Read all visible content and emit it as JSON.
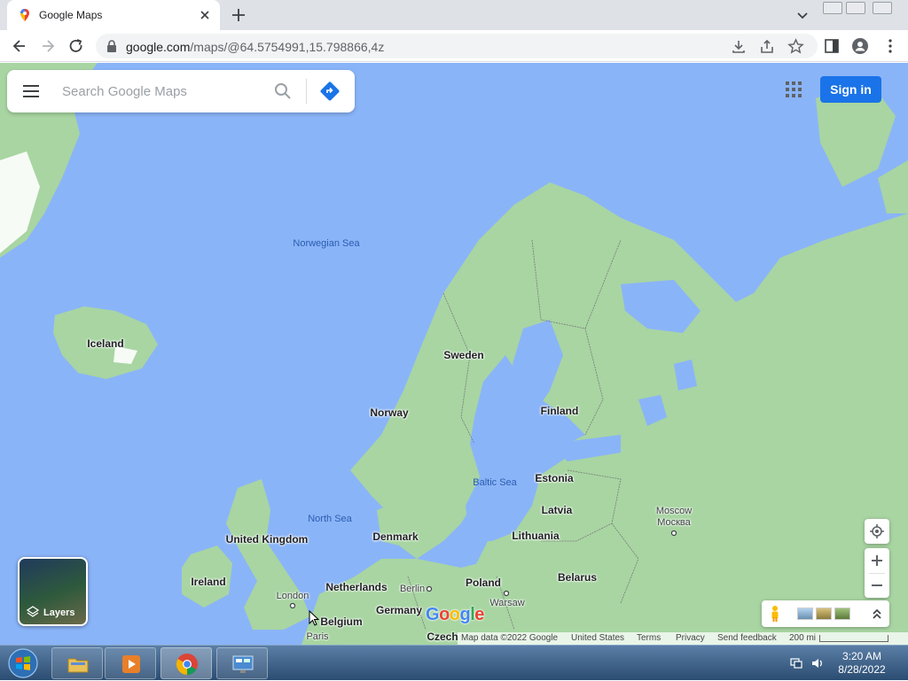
{
  "browser": {
    "tab_title": "Google Maps",
    "url_host": "google.com",
    "url_path": "/maps/@64.5754991,15.798866,4z"
  },
  "maps": {
    "search_placeholder": "Search Google Maps",
    "sign_in_label": "Sign in",
    "layers_label": "Layers",
    "logo_text": "Google",
    "logo_colors": [
      "#4285f4",
      "#ea4335",
      "#fbbc05",
      "#4285f4",
      "#34a853",
      "#ea4335"
    ],
    "footer": {
      "map_data": "Map data ©2022 Google",
      "region": "United States",
      "terms": "Terms",
      "privacy": "Privacy",
      "feedback": "Send feedback",
      "scale": "200 mi"
    }
  },
  "map_labels": {
    "countries": [
      {
        "name": "Iceland"
      },
      {
        "name": "Sweden"
      },
      {
        "name": "Norway"
      },
      {
        "name": "Finland"
      },
      {
        "name": "Estonia"
      },
      {
        "name": "Latvia"
      },
      {
        "name": "Lithuania"
      },
      {
        "name": "Denmark"
      },
      {
        "name": "United Kingdom"
      },
      {
        "name": "Ireland"
      },
      {
        "name": "Netherlands"
      },
      {
        "name": "Belgium"
      },
      {
        "name": "Germany"
      },
      {
        "name": "Poland"
      },
      {
        "name": "Belarus"
      },
      {
        "name": "Czech"
      }
    ],
    "seas": [
      {
        "name": "Norwegian Sea"
      },
      {
        "name": "North Sea"
      },
      {
        "name": "Baltic Sea"
      }
    ],
    "cities": [
      {
        "name": "Moscow"
      },
      {
        "name": "Москва"
      },
      {
        "name": "London"
      },
      {
        "name": "Berlin"
      },
      {
        "name": "Warsaw"
      },
      {
        "name": "Paris"
      }
    ]
  },
  "taskbar": {
    "time": "3:20 AM",
    "date": "8/28/2022"
  },
  "colors": {
    "water": "#8ab4f8",
    "land": "#a8d5a2",
    "accent": "#1a73e8"
  }
}
